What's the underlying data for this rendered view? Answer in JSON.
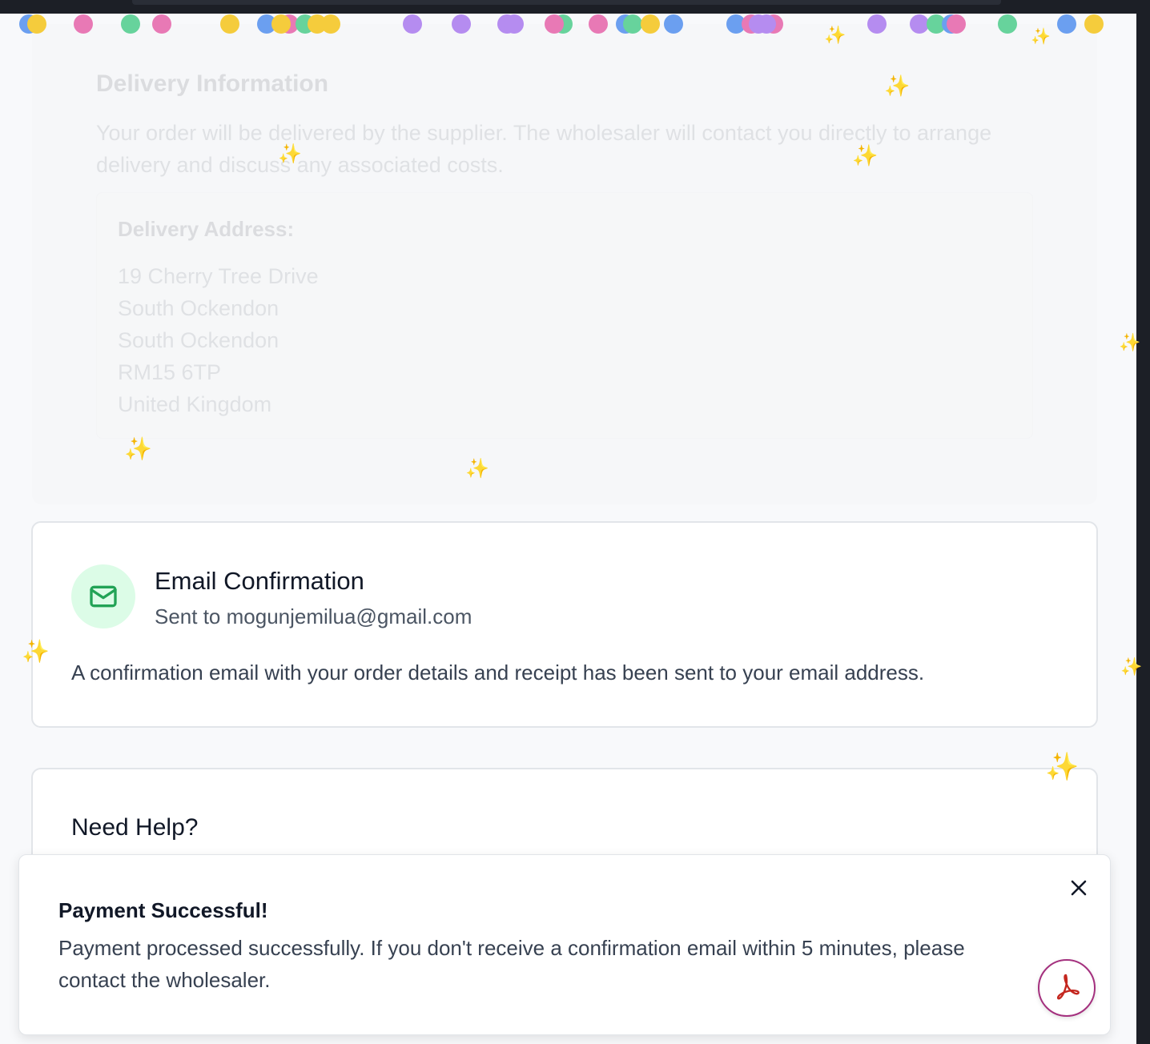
{
  "delivery": {
    "title": "Delivery Information",
    "description": "Your order will be delivered by the supplier. The wholesaler will contact you directly to arrange delivery and discuss any associated costs.",
    "address_label": "Delivery Address:",
    "address_lines": [
      "19 Cherry Tree Drive",
      "South Ockendon",
      "South Ockendon",
      "RM15 6TP",
      "United Kingdom"
    ]
  },
  "email_confirmation": {
    "icon": "mail-icon",
    "title": "Email Confirmation",
    "sent_to": "Sent to mogunjemilua@gmail.com",
    "body": "A confirmation email with your order details and receipt has been sent to your email address."
  },
  "help": {
    "title": "Need Help?"
  },
  "toast": {
    "title": "Payment Successful!",
    "message": "Payment processed successfully. If you don't receive a confirmation email within 5 minutes, please contact the wholesaler.",
    "close_icon": "close-icon"
  },
  "pdf_button": {
    "icon": "adobe-pdf-icon"
  },
  "colors": {
    "confetti_blue": "#6b9ff0",
    "confetti_yellow": "#f5cc3c",
    "confetti_pink": "#e879b5",
    "confetti_green": "#67d39c",
    "confetti_purple": "#b58cf0",
    "sparkle": "#f1c232",
    "success_bg": "#dcfce7",
    "success_icon": "#22a356",
    "pdf_red": "#c4271f"
  }
}
